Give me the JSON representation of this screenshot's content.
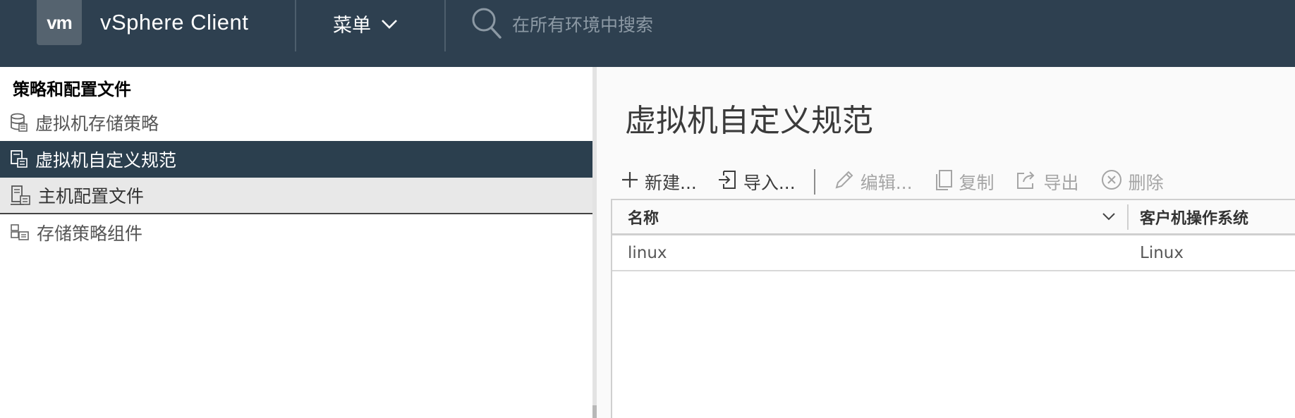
{
  "header": {
    "logo_text": "vm",
    "app_title": "vSphere Client",
    "menu_label": "菜单",
    "search_placeholder": "在所有环境中搜索"
  },
  "sidebar": {
    "title": "策略和配置文件",
    "items": [
      {
        "label": "虚拟机存储策略",
        "icon": "storage-policy-icon",
        "state": "normal"
      },
      {
        "label": "虚拟机自定义规范",
        "icon": "customization-spec-icon",
        "state": "selected"
      },
      {
        "label": "主机配置文件",
        "icon": "host-profile-icon",
        "state": "hover"
      },
      {
        "label": "存储策略组件",
        "icon": "storage-policy-component-icon",
        "state": "normal"
      }
    ]
  },
  "main": {
    "page_title": "虚拟机自定义规范",
    "toolbar": {
      "new_label": "新建...",
      "import_label": "导入...",
      "edit_label": "编辑...",
      "copy_label": "复制",
      "export_label": "导出",
      "delete_label": "删除"
    },
    "table": {
      "columns": [
        "名称",
        "客户机操作系统"
      ],
      "rows": [
        {
          "name": "linux",
          "guest_os": "Linux"
        }
      ]
    }
  },
  "colors": {
    "header_bg": "#2e4050",
    "selected_bg": "#2b3f4e",
    "hover_bg": "#e8e8e8"
  }
}
